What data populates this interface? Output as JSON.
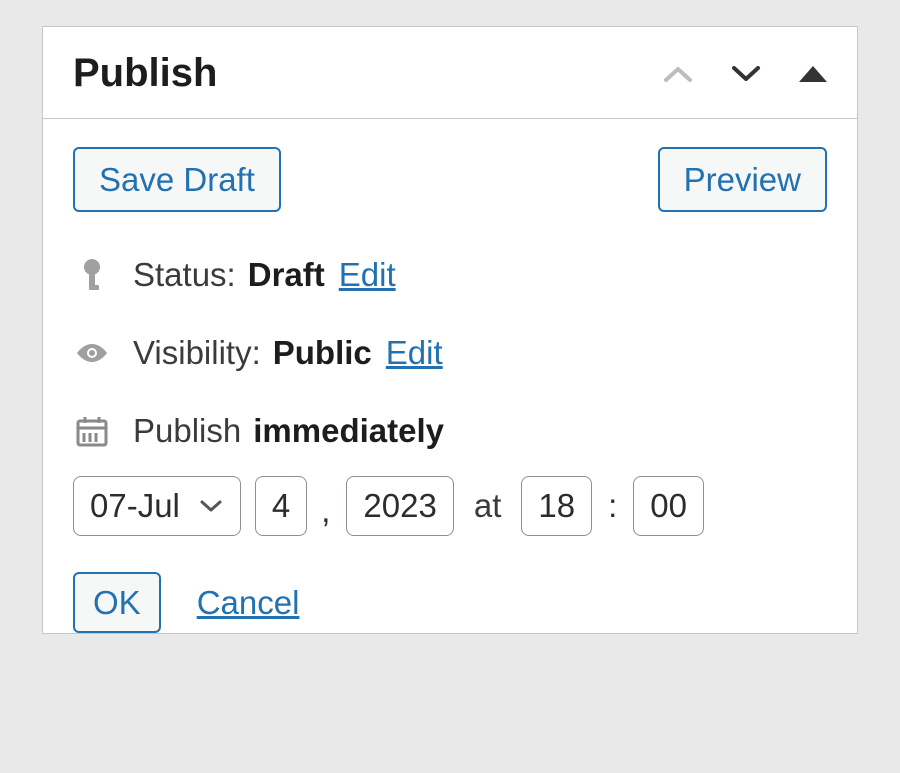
{
  "panel": {
    "title": "Publish"
  },
  "buttons": {
    "save_draft": "Save Draft",
    "preview": "Preview",
    "ok": "OK",
    "cancel": "Cancel"
  },
  "status": {
    "label": "Status:",
    "value": "Draft",
    "edit": "Edit"
  },
  "visibility": {
    "label": "Visibility:",
    "value": "Public",
    "edit": "Edit"
  },
  "publish": {
    "label": "Publish",
    "mode": "immediately"
  },
  "date": {
    "month": "07-Jul",
    "day": "4",
    "year": "2023",
    "at_label": "at",
    "hour": "18",
    "minute": "00",
    "separator": ":"
  }
}
